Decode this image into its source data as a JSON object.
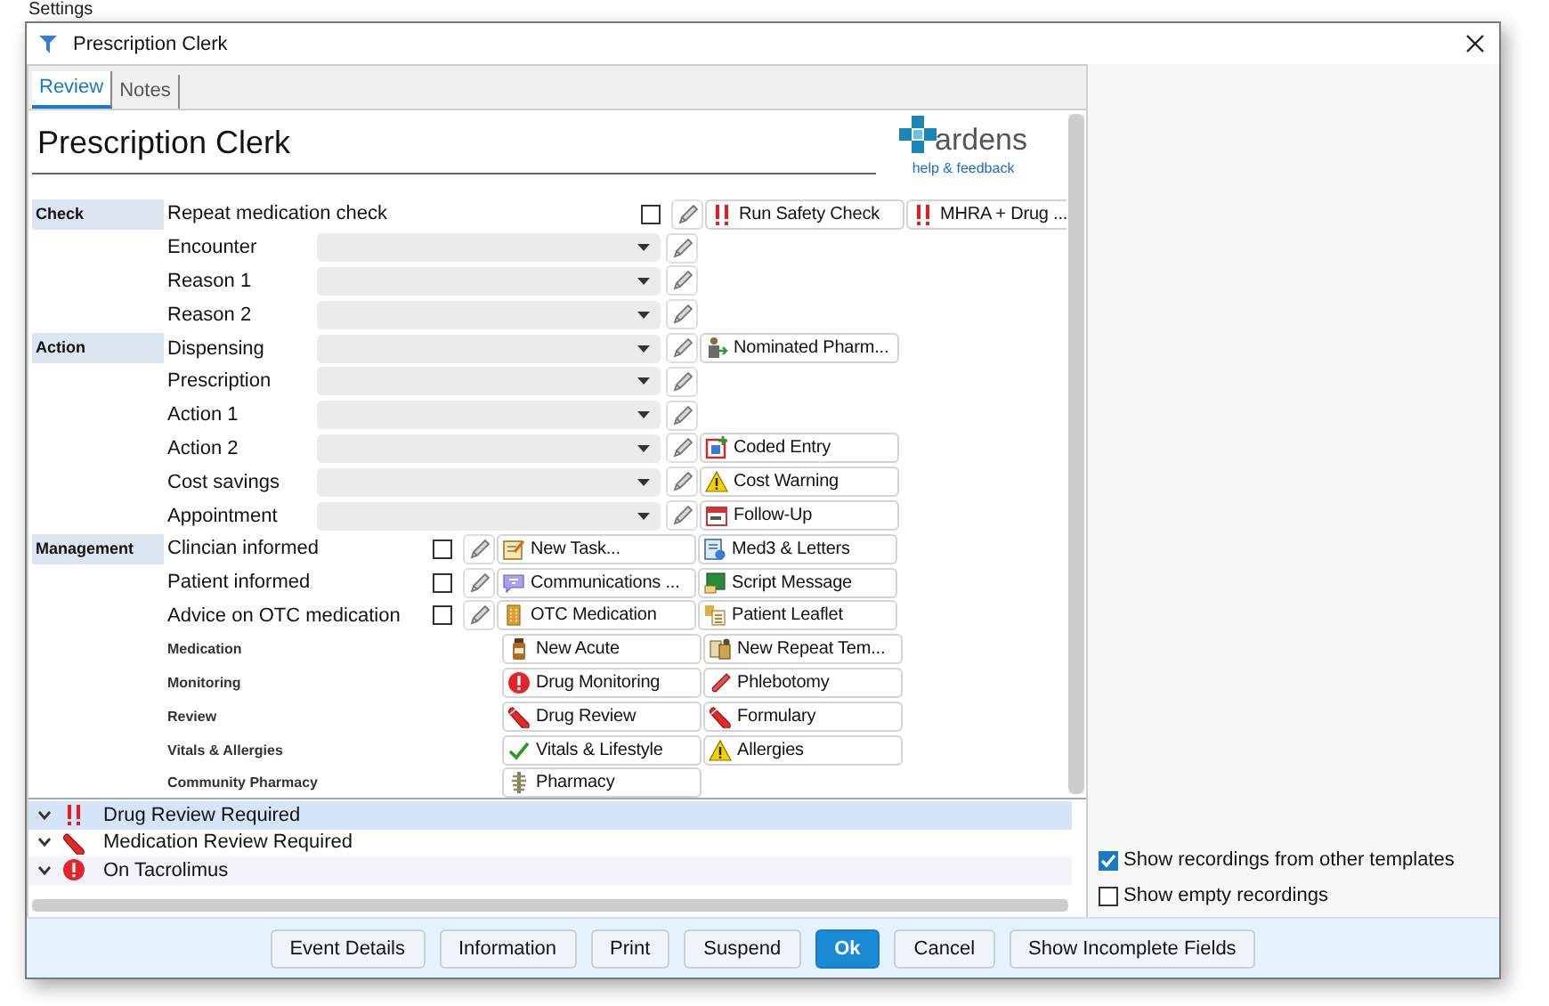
{
  "background": {
    "text": "Settings"
  },
  "window": {
    "title": "Prescription Clerk"
  },
  "tabs": [
    {
      "label": "Review",
      "selected": true
    },
    {
      "label": "Notes",
      "selected": false
    }
  ],
  "template": {
    "title": "Prescription Clerk",
    "logo": {
      "name": "ardens",
      "link": "help & feedback"
    }
  },
  "sections": [
    {
      "label": "Check",
      "rows": [
        {
          "label": "Repeat medication check",
          "kind": "check-right",
          "checked": false,
          "buttons": [
            {
              "label": "Run Safety Check",
              "kind": "alert2"
            },
            {
              "label": "MHRA + Drug ...",
              "kind": "alert2"
            }
          ]
        },
        {
          "label": "Encounter",
          "kind": "dropdown",
          "buttons": []
        },
        {
          "label": "Reason 1",
          "kind": "dropdown",
          "buttons": []
        },
        {
          "label": "Reason 2",
          "kind": "dropdown",
          "buttons": []
        }
      ]
    },
    {
      "label": "Action",
      "rows": [
        {
          "label": "Dispensing",
          "kind": "dropdown",
          "buttons": [
            {
              "label": "Nominated Pharm...",
              "kind": "pharm"
            }
          ]
        },
        {
          "label": "Prescription",
          "kind": "dropdown",
          "buttons": []
        },
        {
          "label": "Action 1",
          "kind": "dropdown",
          "buttons": []
        },
        {
          "label": "Action 2",
          "kind": "dropdown",
          "buttons": [
            {
              "label": "Coded Entry",
              "kind": "coded"
            }
          ]
        },
        {
          "label": "Cost savings",
          "kind": "dropdown",
          "buttons": [
            {
              "label": "Cost Warning",
              "kind": "warning"
            }
          ]
        },
        {
          "label": "Appointment",
          "kind": "dropdown",
          "buttons": [
            {
              "label": "Follow-Up",
              "kind": "calendar"
            }
          ]
        }
      ]
    },
    {
      "label": "Management",
      "rows": [
        {
          "label": "Clincian informed",
          "kind": "check-left",
          "checked": false,
          "buttons": [
            {
              "label": "New Task...",
              "kind": "task"
            },
            {
              "label": "Med3 & Letters",
              "kind": "letters"
            }
          ]
        },
        {
          "label": "Patient informed",
          "kind": "check-left",
          "checked": false,
          "buttons": [
            {
              "label": "Communications ...",
              "kind": "chat"
            },
            {
              "label": "Script Message",
              "kind": "script"
            }
          ]
        },
        {
          "label": "Advice on OTC medication",
          "kind": "check-left",
          "checked": false,
          "buttons": [
            {
              "label": "OTC Medication",
              "kind": "otc"
            },
            {
              "label": "Patient Leaflet",
              "kind": "leaflet"
            }
          ]
        },
        {
          "label": "Medication",
          "kind": "heading",
          "buttons": [
            {
              "label": "New Acute",
              "kind": "bottle"
            },
            {
              "label": "New Repeat Tem...",
              "kind": "repeat"
            }
          ]
        },
        {
          "label": "Monitoring",
          "kind": "heading",
          "buttons": [
            {
              "label": "Drug Monitoring",
              "kind": "alert"
            },
            {
              "label": "Phlebotomy",
              "kind": "tube"
            }
          ]
        },
        {
          "label": "Review",
          "kind": "heading",
          "buttons": [
            {
              "label": "Drug Review",
              "kind": "pill"
            },
            {
              "label": "Formulary",
              "kind": "pill"
            }
          ]
        },
        {
          "label": "Vitals & Allergies",
          "kind": "heading",
          "buttons": [
            {
              "label": "Vitals & Lifestyle",
              "kind": "tick"
            },
            {
              "label": "Allergies",
              "kind": "warning"
            }
          ]
        },
        {
          "label": "Community Pharmacy",
          "kind": "heading",
          "buttons": [
            {
              "label": "Pharmacy",
              "kind": "pharmacy"
            }
          ]
        }
      ]
    }
  ],
  "alerts": [
    {
      "label": "Drug Review Required",
      "kind": "alert2",
      "expanded": true,
      "selected": true
    },
    {
      "label": "Medication Review Required",
      "kind": "pill",
      "expanded": true,
      "selected": false
    },
    {
      "label": "On Tacrolimus",
      "kind": "alert",
      "expanded": true,
      "selected": false
    }
  ],
  "options": [
    {
      "label": "Show recordings from other templates",
      "checked": true
    },
    {
      "label": "Show empty recordings",
      "checked": false
    }
  ],
  "buttons": [
    {
      "label": "Event Details",
      "primary": false
    },
    {
      "label": "Information",
      "primary": false
    },
    {
      "label": "Print",
      "primary": false
    },
    {
      "label": "Suspend",
      "primary": false
    },
    {
      "label": "Ok",
      "primary": true
    },
    {
      "label": "Cancel",
      "primary": false
    },
    {
      "label": "Show Incomplete Fields",
      "primary": false
    }
  ]
}
